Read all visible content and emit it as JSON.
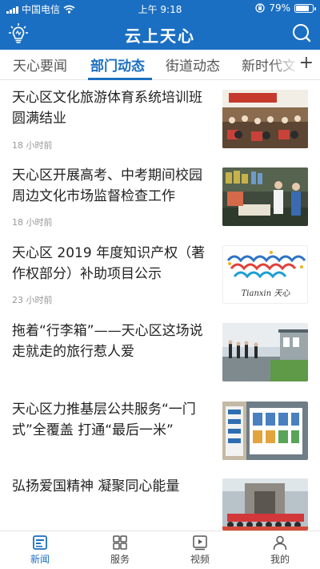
{
  "status_bar": {
    "carrier": "中国电信",
    "time": "上午 9:18",
    "battery_percent": "79%",
    "battery_level": 0.79
  },
  "header": {
    "app_title": "云上天心",
    "bulb_icon": "lightbulb-icon",
    "search_icon": "search-icon"
  },
  "tabs": [
    {
      "label": "天心要闻",
      "active": false
    },
    {
      "label": "部门动态",
      "active": true
    },
    {
      "label": "街道动态",
      "active": false
    },
    {
      "label": "新时代文",
      "active": false
    }
  ],
  "add_channel_label": "+",
  "news": [
    {
      "title": "天心区文化旅游体育系统培训班圆满结业",
      "time": "18 小时前"
    },
    {
      "title": "天心区开展高考、中考期间校园周边文化市场监督检查工作",
      "time": "18 小时前"
    },
    {
      "title": "天心区 2019 年度知识产权（著作权部分）补助项目公示",
      "time": "23 小时前",
      "thumb_text": "Tianxin 天心"
    },
    {
      "title": "拖着“行李箱”——天心区这场说走就走的旅行惹人爱",
      "time": ""
    },
    {
      "title": "天心区力推基层公共服务“一门式”全覆盖  打通“最后一米”",
      "time": ""
    },
    {
      "title": "弘扬爱国精神  凝聚同心能量",
      "time": ""
    }
  ],
  "bottom_nav": [
    {
      "label": "新闻",
      "icon": "news-icon",
      "active": true
    },
    {
      "label": "服务",
      "icon": "grid-icon",
      "active": false
    },
    {
      "label": "视频",
      "icon": "video-icon",
      "active": false
    },
    {
      "label": "我的",
      "icon": "person-icon",
      "active": false
    }
  ],
  "colors": {
    "brand_blue": "#1b6fc2",
    "text_dark": "#222222",
    "text_muted": "#999999"
  }
}
